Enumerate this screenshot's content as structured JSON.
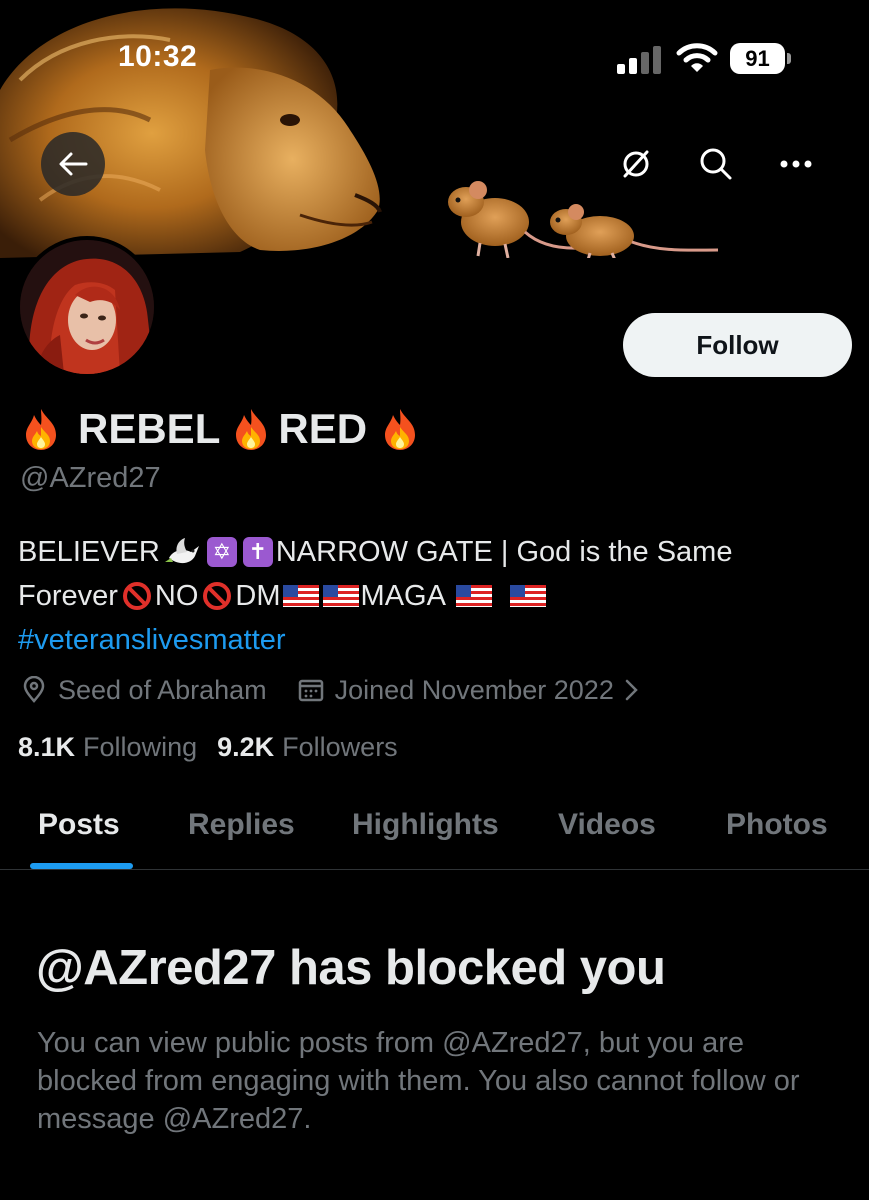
{
  "status_bar": {
    "time": "10:32",
    "battery": "91"
  },
  "profile": {
    "name_part1": "REBEL",
    "name_part2": "RED",
    "handle": "@AZred27",
    "follow_label": "Follow",
    "bio_line1_a": "BELIEVER",
    "bio_line1_b": "NARROW GATE | God is the Same",
    "bio_line2_a": "Forever",
    "bio_line2_b": "NO",
    "bio_line2_c": "DM",
    "bio_line2_d": "MAGA",
    "hashtag": "#veteranslivesmatter",
    "location": "Seed of Abraham",
    "joined": "Joined November 2022",
    "following_count": "8.1K",
    "following_label": "Following",
    "followers_count": "9.2K",
    "followers_label": "Followers"
  },
  "tabs": [
    {
      "label": "Posts",
      "active": true
    },
    {
      "label": "Replies"
    },
    {
      "label": "Highlights"
    },
    {
      "label": "Videos"
    },
    {
      "label": "Photos"
    }
  ],
  "blocked": {
    "title": "@AZred27 has blocked you",
    "description": "You can view public posts from @AZred27, but you are blocked from engaging with them. You also cannot follow or message @AZred27."
  },
  "icons": {
    "back": "arrow-left-icon",
    "circle": "notifications-off-icon",
    "search": "search-icon",
    "more": "more-icon",
    "location": "location-pin-icon",
    "calendar": "calendar-icon",
    "chevron": "chevron-right-icon"
  },
  "colors": {
    "accent": "#1d9bf0",
    "muted": "#71767b",
    "text": "#e7e9ea",
    "background": "#000000"
  }
}
